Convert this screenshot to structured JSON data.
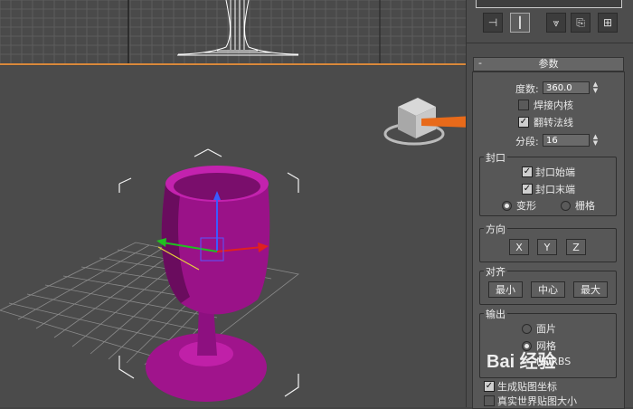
{
  "panel": {
    "tabs": [
      {
        "name": "pin-icon",
        "glyph": "⊣"
      },
      {
        "name": "modifier-icon",
        "glyph": "┃"
      },
      {
        "name": "unique-icon",
        "glyph": "⩔"
      },
      {
        "name": "remove-modifier-icon",
        "glyph": "⎘"
      },
      {
        "name": "configure-icon",
        "glyph": "⊞"
      }
    ],
    "rollout_minus": "-",
    "rollout_title": "参数",
    "degrees_label": "度数:",
    "degrees_value": "360.0",
    "weld_core_label": "焊接内核",
    "flip_normals_label": "翻转法线",
    "segments_label": "分段:",
    "segments_value": "16",
    "capping": {
      "title": "封口",
      "cap_start": "封口始端",
      "cap_end": "封口末端",
      "morph": "变形",
      "grid": "栅格"
    },
    "direction": {
      "title": "方向",
      "x": "X",
      "y": "Y",
      "z": "Z"
    },
    "align": {
      "title": "对齐",
      "min": "最小",
      "center": "中心",
      "max": "最大"
    },
    "output": {
      "title": "输出",
      "patch": "面片",
      "mesh": "网格",
      "nurbs": "NURBS",
      "gen_map_coords": "生成贴图坐标",
      "real_world_map": "真实世界贴图大小"
    }
  },
  "watermark": "Bai 经验",
  "colors": {
    "accent_orange": "#e86a1a",
    "goblet_magenta": "#a0148c",
    "viewport_border": "#d9883a"
  }
}
